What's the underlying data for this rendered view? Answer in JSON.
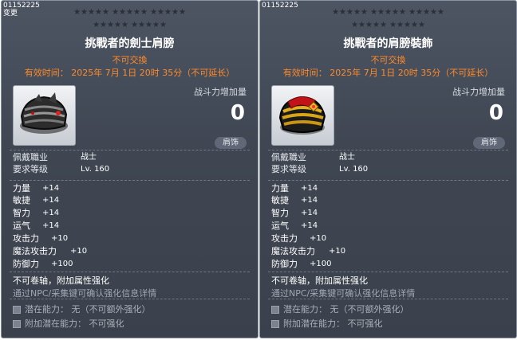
{
  "cards": [
    {
      "id_text": "01152225",
      "sub_text": "变更",
      "stars_row1": "★★★★★  ★★★★★  ★★★★★",
      "stars_row2": "★★★★★  ★★★★★",
      "title": "挑戰者的劍士肩膀",
      "tradable": "不可交換",
      "expiry": "有效时间： 2025年 7月 1日 20时 35分（不可延长）",
      "power_label": "战斗力增加量",
      "power_value": "0",
      "slot": "肩饰",
      "job_label": "佩戴職业",
      "job_value": "战士",
      "level_label": "要求等级",
      "level_value": "Lv. 160",
      "stats": [
        {
          "label": "力量",
          "value": "+14"
        },
        {
          "label": "敏捷",
          "value": "+14"
        },
        {
          "label": "智力",
          "value": "+14"
        },
        {
          "label": "运气",
          "value": "+14"
        },
        {
          "label": "攻击力",
          "value": "+10"
        },
        {
          "label": "魔法攻击力",
          "value": "+10"
        },
        {
          "label": "防御力",
          "value": "+100"
        }
      ],
      "note1": "不可卷轴，附加属性强化",
      "note2": "通过NPC/采集键可确认强化信息详情",
      "potential1": "潜在能力： 无（不可额外强化）",
      "potential2": "附加潜在能力： 不可强化",
      "icon": "dark-helmet-shoulder-icon"
    },
    {
      "id_text": "01152225",
      "stars_row1": "★★★★★  ★★★★★  ★★★★★",
      "stars_row2": "★★★★★  ★★★★★",
      "title": "挑戰者的肩膀裝飾",
      "tradable": "不可交換",
      "expiry": "有效时间： 2025年 7月 1日 20时 35分（不可延长）",
      "power_label": "战斗力增加量",
      "power_value": "0",
      "slot": "肩饰",
      "job_label": "佩戴職业",
      "job_value": "战士",
      "level_label": "要求等级",
      "level_value": "Lv. 160",
      "stats": [
        {
          "label": "力量",
          "value": "+14"
        },
        {
          "label": "敏捷",
          "value": "+14"
        },
        {
          "label": "智力",
          "value": "+14"
        },
        {
          "label": "运气",
          "value": "+14"
        },
        {
          "label": "攻击力",
          "value": "+10"
        },
        {
          "label": "魔法攻击力",
          "value": "+10"
        },
        {
          "label": "防御力",
          "value": "+100"
        }
      ],
      "note1": "不可卷轴，附加属性强化",
      "note2": "通过NPC/采集键可确认强化信息详情",
      "potential1": "潜在能力： 无（不可额外强化）",
      "potential2": "附加潜在能力： 不可强化",
      "icon": "gold-red-shoulder-icon"
    }
  ],
  "colors": {
    "orange": "#ff8a2a",
    "panel": "#434a56",
    "muted": "#a9b0ba"
  }
}
